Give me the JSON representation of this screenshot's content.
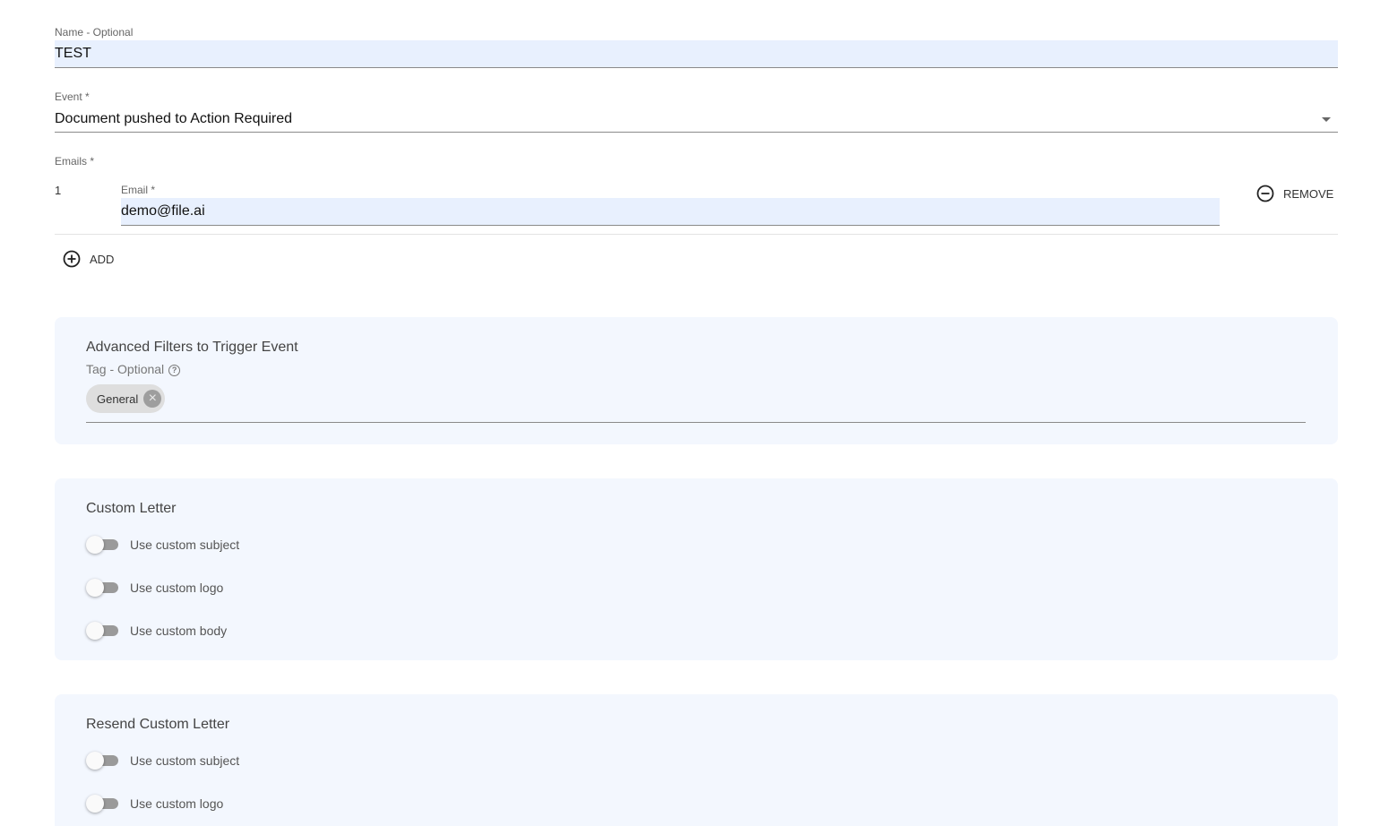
{
  "name_field": {
    "label": "Name - Optional",
    "value": "TEST"
  },
  "event_field": {
    "label": "Event *",
    "value": "Document pushed to Action Required",
    "icon": "caret-down-icon"
  },
  "emails": {
    "label": "Emails *",
    "items": [
      {
        "index": "1",
        "label": "Email *",
        "value": "demo@file.ai"
      }
    ],
    "remove_label": "REMOVE",
    "remove_icon": "minus-circle-icon",
    "add_label": "ADD",
    "add_icon": "plus-circle-icon"
  },
  "advanced_filters": {
    "title": "Advanced Filters to Trigger Event",
    "tag_label": "Tag - Optional",
    "help_icon": "help-circle-icon",
    "help_glyph": "?",
    "chips": [
      {
        "label": "General",
        "remove_icon": "close-circle-icon",
        "remove_glyph": "×"
      }
    ]
  },
  "custom_letter": {
    "title": "Custom Letter",
    "toggles": [
      {
        "label": "Use custom subject",
        "on": false
      },
      {
        "label": "Use custom logo",
        "on": false
      },
      {
        "label": "Use custom body",
        "on": false
      }
    ]
  },
  "resend_custom_letter": {
    "title": "Resend Custom Letter",
    "toggles": [
      {
        "label": "Use custom subject",
        "on": false
      },
      {
        "label": "Use custom logo",
        "on": false
      }
    ]
  },
  "colors": {
    "input_fill": "#e8f0fe",
    "panel_bg": "#f3f7fe",
    "chip_bg": "#dedede",
    "toggle_track": "#9a9a9a"
  }
}
